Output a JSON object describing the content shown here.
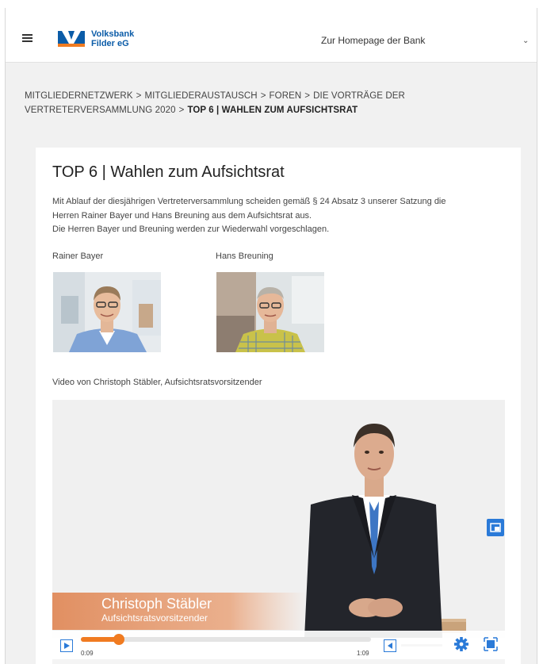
{
  "header": {
    "bank_name_line1": "Volksbank",
    "bank_name_line2": "Filder eG",
    "homepage_link": "Zur Homepage der Bank"
  },
  "breadcrumb": {
    "items": [
      "MITGLIEDERNETZWERK",
      "MITGLIEDERAUSTAUSCH",
      "FOREN",
      "DIE VORTRÄGE DER VERTRETERVERSAMMLUNG 2020"
    ],
    "separator": ">",
    "current": "TOP 6 | WAHLEN ZUM AUFSICHTSRAT"
  },
  "article": {
    "title": "TOP 6 | Wahlen zum Aufsichtsrat",
    "intro_line1": "Mit Ablauf der diesjährigen Vertreterversammlung scheiden gemäß § 24 Absatz 3 unserer Satzung die",
    "intro_line2": "Herren Rainer Bayer und Hans Breuning aus dem Aufsichtsrat aus.",
    "intro_line3": "Die Herren Bayer und Breuning werden zur Wiederwahl vorgeschlagen.",
    "persons": [
      {
        "name": "Rainer Bayer"
      },
      {
        "name": "Hans Breuning"
      }
    ],
    "video_caption": "Video von Christoph Stäbler, Aufsichtsratsvorsitzender"
  },
  "video": {
    "lower_third_name": "Christoph Stäbler",
    "lower_third_role": "Aufsichtsratsvorsitzender",
    "current_time": "0:09",
    "total_time": "1:09",
    "progress_fraction": 0.13
  },
  "colors": {
    "brand_blue": "#0b5ca8",
    "brand_orange": "#f07b21",
    "control_blue": "#2a7ad8"
  }
}
